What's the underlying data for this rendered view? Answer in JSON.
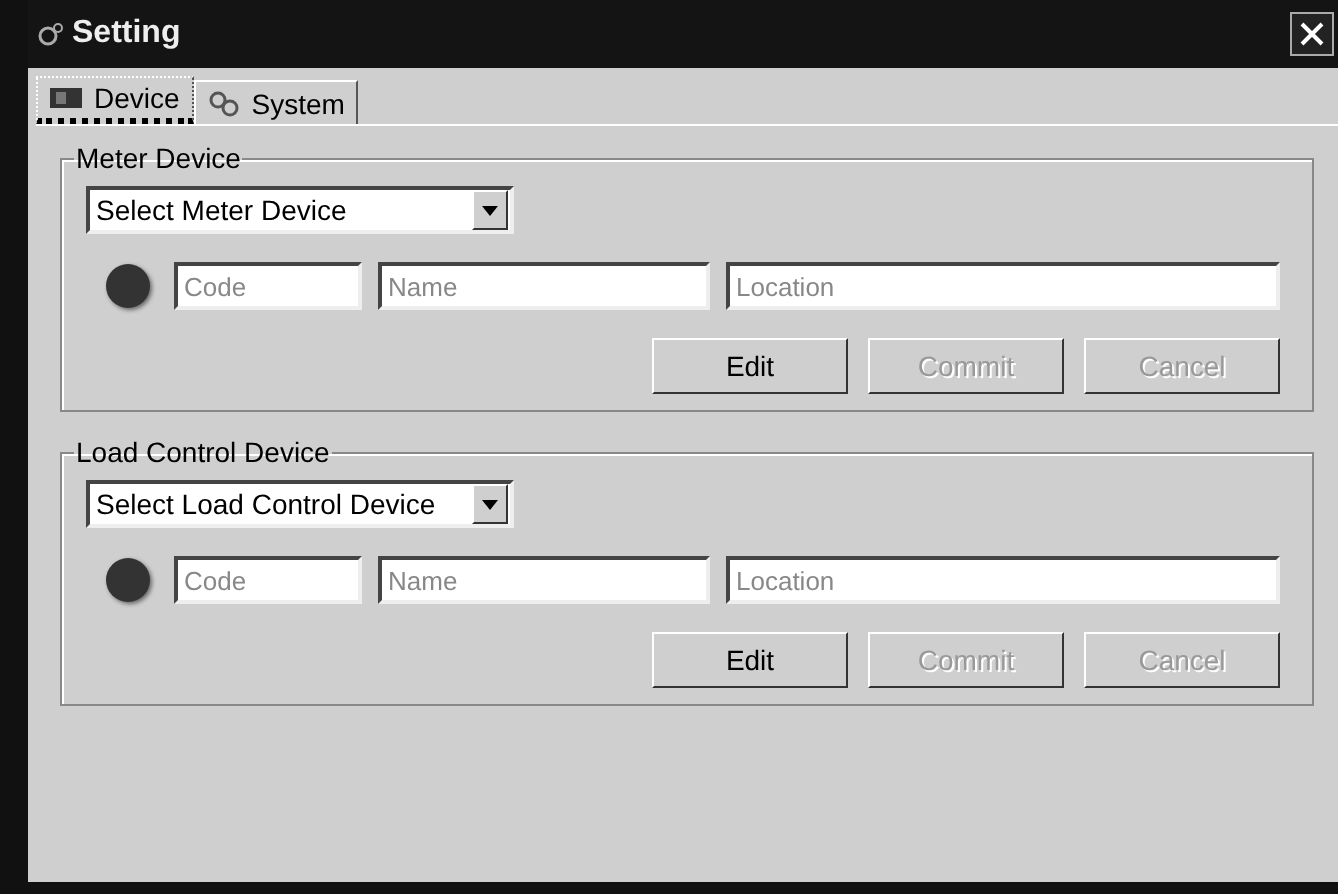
{
  "window": {
    "title": "Setting"
  },
  "tabs": [
    {
      "label": "Device",
      "selected": true,
      "kind": "device"
    },
    {
      "label": "System",
      "selected": false,
      "kind": "system"
    }
  ],
  "groups": [
    {
      "title": "Meter Device",
      "dropdown": {
        "value": "Select Meter Device"
      },
      "indicator": {
        "on": false
      },
      "fields": [
        {
          "placeholder": "Code"
        },
        {
          "placeholder": "Name"
        },
        {
          "placeholder": "Location"
        }
      ],
      "buttons": [
        {
          "label": "Edit",
          "disabled": false
        },
        {
          "label": "Commit",
          "disabled": true
        },
        {
          "label": "Cancel",
          "disabled": true
        }
      ]
    },
    {
      "title": "Load Control Device",
      "dropdown": {
        "value": "Select Load Control Device"
      },
      "indicator": {
        "on": false
      },
      "fields": [
        {
          "placeholder": "Code"
        },
        {
          "placeholder": "Name"
        },
        {
          "placeholder": "Location"
        }
      ],
      "buttons": [
        {
          "label": "Edit",
          "disabled": false
        },
        {
          "label": "Commit",
          "disabled": true
        },
        {
          "label": "Cancel",
          "disabled": true
        }
      ]
    }
  ]
}
